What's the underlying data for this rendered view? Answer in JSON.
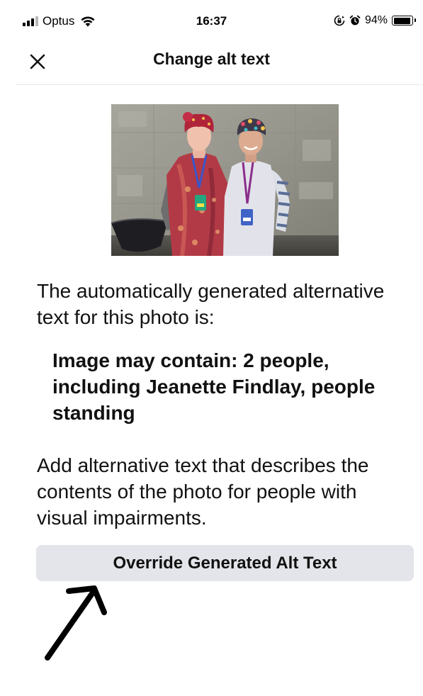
{
  "status_bar": {
    "carrier": "Optus",
    "time": "16:37",
    "battery_percent": "94%",
    "battery_level": 0.94,
    "icons": [
      "signal-icon",
      "wifi-icon",
      "screen-lock-icon",
      "alarm-icon",
      "battery-icon"
    ]
  },
  "nav": {
    "title": "Change alt text",
    "close_icon": "close-icon"
  },
  "photo": {
    "description_icon": "photo"
  },
  "content": {
    "intro": "The automatically generated alternative text for this photo is:",
    "generated_alt_text": "Image may contain: 2 people, including Jeanette Findlay, people standing",
    "instructions": "Add alternative text that describes the contents of the photo for people with visual impairments."
  },
  "actions": {
    "override_label": "Override Generated Alt Text"
  },
  "colors": {
    "button_bg": "#e4e5ea",
    "divider": "#e6e6e6",
    "text": "#111111"
  }
}
